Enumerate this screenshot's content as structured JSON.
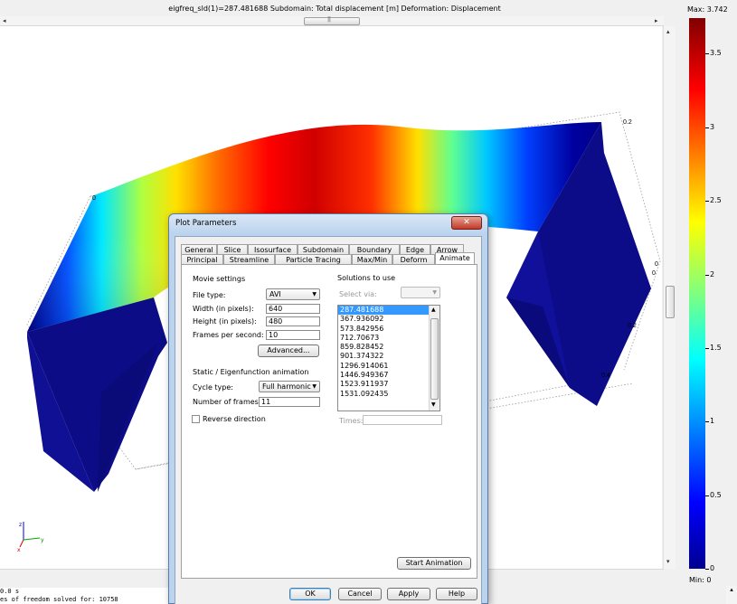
{
  "plot": {
    "title": "eigfreq_sld(1)=287.481688   Subdomain: Total displacement [m]   Deformation: Displacement",
    "axis_labels": [
      "0",
      "0.2",
      "0",
      "0",
      "0.2",
      "0.4"
    ],
    "triad": {
      "z": "z",
      "y": "y",
      "x": "x"
    }
  },
  "colorbar": {
    "max_label": "Max: 3.742",
    "min_label": "Min: 0",
    "ticks": [
      {
        "value": 3.5,
        "label": "3.5"
      },
      {
        "value": 3,
        "label": "3"
      },
      {
        "value": 2.5,
        "label": "2.5"
      },
      {
        "value": 2,
        "label": "2"
      },
      {
        "value": 1.5,
        "label": "1.5"
      },
      {
        "value": 1,
        "label": "1"
      },
      {
        "value": 0.5,
        "label": "0.5"
      },
      {
        "value": 0,
        "label": "0"
      }
    ],
    "max": 3.742,
    "min": 0
  },
  "console": {
    "line1": "0.0 s",
    "line2": "es of freedom solved for: 10758"
  },
  "dialog": {
    "title": "Plot Parameters",
    "tabs_row1": [
      "General",
      "Slice",
      "Isosurface",
      "Subdomain",
      "Boundary",
      "Edge",
      "Arrow"
    ],
    "tabs_row2": [
      "Principal",
      "Streamline",
      "Particle Tracing",
      "Max/Min",
      "Deform",
      "Animate"
    ],
    "active_tab": "Animate",
    "movie": {
      "group": "Movie settings",
      "file_type_label": "File type:",
      "file_type": "AVI",
      "width_label": "Width (in pixels):",
      "width": "640",
      "height_label": "Height (in pixels):",
      "height": "480",
      "fps_label": "Frames per second:",
      "fps": "10",
      "advanced": "Advanced..."
    },
    "anim": {
      "group": "Static / Eigenfunction animation",
      "cycle_label": "Cycle type:",
      "cycle": "Full harmonic",
      "frames_label": "Number of frames:",
      "frames": "11",
      "reverse": "Reverse direction"
    },
    "solutions": {
      "group": "Solutions to use",
      "select_via_label": "Select via:",
      "items": [
        "287.481688",
        "367.936092",
        "573.842956",
        "712.70673",
        "859.828452",
        "901.374322",
        "1296.914061",
        "1446.949367",
        "1523.911937",
        "1531.092435"
      ],
      "times_label": "Times:"
    },
    "start_animation": "Start Animation",
    "ok": "OK",
    "cancel": "Cancel",
    "apply": "Apply",
    "help": "Help"
  }
}
